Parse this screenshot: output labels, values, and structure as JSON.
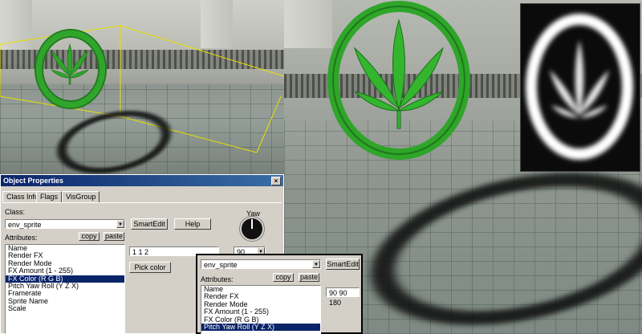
{
  "dialog": {
    "title": "Object Properties",
    "close_label": "×",
    "tabs": [
      "Class Info",
      "Flags",
      "VisGroup"
    ],
    "class_label": "Class:",
    "class_value": "env_sprite",
    "smartedit_label": "SmartEdit",
    "help_label": "Help",
    "yaw_label": "Yaw",
    "attributes_label": "Attributes:",
    "copy_label": "copy",
    "paste_label": "paste",
    "attributes": [
      "Name",
      "Render FX",
      "Render Mode",
      "FX Amount (1 - 255)",
      "FX Color (R G B)",
      "Pitch Yaw Roll (Y Z X)",
      "Framerate",
      "Sprite Name",
      "Scale"
    ],
    "selected_attribute": 4,
    "value_field": "1 1 2",
    "yaw_value": "90",
    "pick_color_label": "Pick color"
  },
  "inset": {
    "class_value": "env_sprite",
    "smartedit_label": "SmartEdit",
    "attributes_label": "Attributes:",
    "copy_label": "copy",
    "paste_label": "paste",
    "attributes": [
      "Name",
      "Render FX",
      "Render Mode",
      "FX Amount (1 - 255)",
      "FX Color (R G B)",
      "Pitch Yaw Roll (Y Z X)"
    ],
    "selected_attribute": 5,
    "value_field": "90 90 180"
  },
  "colors": {
    "sprite_green": "#2fa52a",
    "selection": "#0a246a",
    "bounding_box": "#e8e000"
  }
}
